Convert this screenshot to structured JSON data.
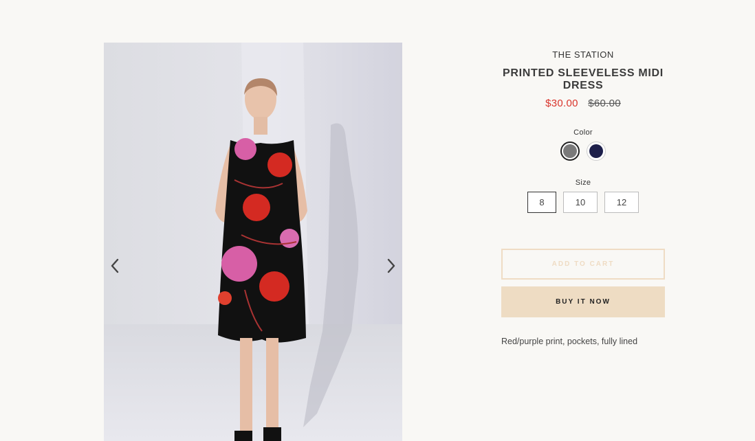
{
  "product": {
    "vendor": "THE STATION",
    "title": "PRINTED SLEEVELESS MIDI DRESS",
    "sale_price": "$30.00",
    "compare_price": "$60.00",
    "description": "Red/purple print, pockets, fully lined"
  },
  "options": {
    "color_label": "Color",
    "colors": [
      {
        "name": "Grey",
        "hex": "#7a7a7a",
        "selected": true
      },
      {
        "name": "Navy",
        "hex": "#1d1f4a",
        "selected": false
      }
    ],
    "size_label": "Size",
    "sizes": [
      {
        "label": "8",
        "selected": true
      },
      {
        "label": "10",
        "selected": false
      },
      {
        "label": "12",
        "selected": false
      }
    ]
  },
  "actions": {
    "add_to_cart": "ADD TO CART",
    "buy_now": "BUY IT NOW"
  },
  "gallery": {
    "prev_icon": "chevron-left-icon",
    "next_icon": "chevron-right-icon"
  },
  "colors": {
    "sale": "#d9342b",
    "button_accent": "#eedcc3",
    "background": "#f9f8f5"
  }
}
